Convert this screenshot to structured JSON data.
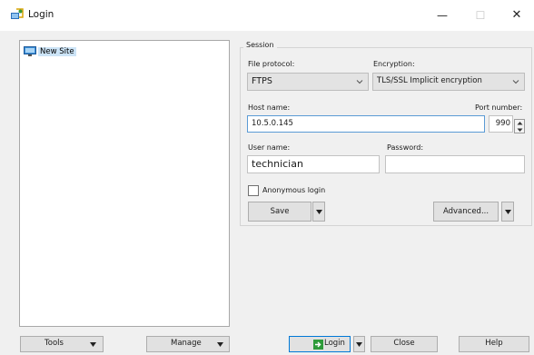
{
  "window": {
    "title": "Login",
    "minimize": "—",
    "maximize": "☐",
    "close": "✕"
  },
  "site_tree": {
    "items": [
      {
        "label": "New Site"
      }
    ]
  },
  "session": {
    "legend": "Session",
    "file_protocol": {
      "label": "File protocol:",
      "value": "FTPS"
    },
    "encryption": {
      "label": "Encryption:",
      "value": "TLS/SSL Implicit encryption"
    },
    "host": {
      "label": "Host name:",
      "value": "10.5.0.145"
    },
    "port": {
      "label": "Port number:",
      "value": "990"
    },
    "user": {
      "label": "User name:",
      "value": "technician"
    },
    "password": {
      "label": "Password:",
      "value": ""
    },
    "anonymous_login": {
      "label": "Anonymous login",
      "checked": false
    },
    "save_label": "Save",
    "advanced_label": "Advanced..."
  },
  "bottom": {
    "tools_label": "Tools",
    "manage_label": "Manage",
    "login_label": "Login",
    "close_label": "Close",
    "help_label": "Help"
  },
  "icons": {
    "app": "app-login-icon",
    "site": "site-computer-icon",
    "dropdown": "chevron-down-icon",
    "login": "login-arrow-icon"
  },
  "colors": {
    "accent": "#0078d7",
    "selection": "#cce4f7",
    "login_icon": "#2e9b3a"
  }
}
